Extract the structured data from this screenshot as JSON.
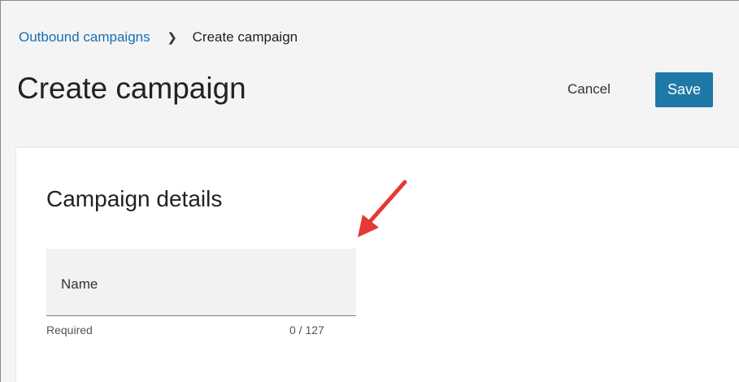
{
  "breadcrumb": {
    "parent": "Outbound campaigns",
    "current": "Create campaign"
  },
  "header": {
    "title": "Create campaign",
    "cancel_label": "Cancel",
    "save_label": "Save"
  },
  "section": {
    "heading": "Campaign details",
    "name_label": "Name",
    "helper_text": "Required",
    "char_count": "0 / 127"
  },
  "colors": {
    "link": "#1a6fb3",
    "primary_button": "#1f79a8",
    "annotation_arrow": "#e53935"
  },
  "icons": {
    "breadcrumb_separator": "chevron-right-icon",
    "annotation": "red-arrow-icon"
  }
}
